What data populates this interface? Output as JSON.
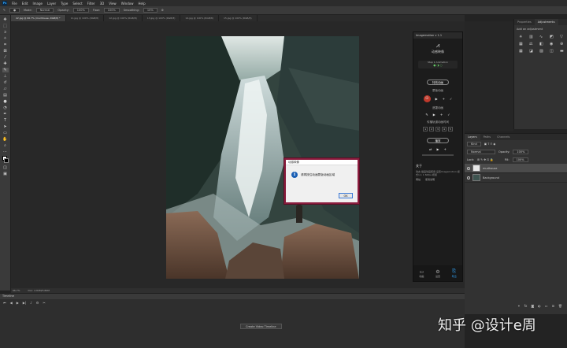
{
  "menubar": {
    "app_logo": "Ps",
    "items": [
      "File",
      "Edit",
      "Image",
      "Layer",
      "Type",
      "Select",
      "Filter",
      "3D",
      "View",
      "Window",
      "Help"
    ]
  },
  "options": {
    "tool_icon": "brush-icon",
    "mode_label": "Mode:",
    "mode_value": "Normal",
    "opacity_label": "Opacity:",
    "opacity_value": "100%",
    "flow_label": "Flow:",
    "flow_value": "100%",
    "smoothing_label": "Smoothing:",
    "smoothing_value": "10%"
  },
  "tabs": [
    {
      "label": "22.jpg @ 66.7% (mudhouse, RGB/8) *",
      "active": true
    },
    {
      "label": "11.jpg @ 100% (RGB/8)",
      "active": false
    },
    {
      "label": "12.jpg @ 100% (RGB/8)",
      "active": false
    },
    {
      "label": "13.jpg @ 100% (RGB/8)",
      "active": false
    },
    {
      "label": "14.jpg @ 100% (RGB/8)",
      "active": false
    },
    {
      "label": "15.jpg @ 100% (RGB/8)",
      "active": false
    }
  ],
  "status": {
    "zoom": "66.7%",
    "doc": "Doc: 2.64M/5.89M"
  },
  "timeline": {
    "title": "Timeline",
    "create_button": "Create Video Timeline"
  },
  "plugin": {
    "title": "Imagemotion v 1.1",
    "brand": "动感映像",
    "sub": "Step 1 Animation",
    "section1_button": "特效动画",
    "group1_label": "蒙版动画",
    "group2_label": "遮罩动画",
    "group3_label": "传播轨道动画时间",
    "section2_button": "播放",
    "about_title": "关于",
    "about_text": "动态 插画动画使用 设置Imagemotion 模式1.1 1 60fps 视频",
    "link1": "网站",
    "link2": "使用说明",
    "bottom_left": "动画",
    "bottom_mid": "设置",
    "bottom_right": "导出"
  },
  "properties_panel": {
    "tabs": [
      "Properties",
      "Adjustments"
    ],
    "hint": "Add an adjustment"
  },
  "layers_panel": {
    "tabs": [
      "Layers",
      "Paths",
      "Channels"
    ],
    "kind": "Kind",
    "blend": "Normal",
    "opacity_label": "Opacity:",
    "opacity_value": "100%",
    "lock_label": "Lock:",
    "fill_label": "Fill:",
    "fill_value": "100%",
    "layers": [
      {
        "name": "mudhouse",
        "selected": true
      },
      {
        "name": "Background",
        "selected": false
      }
    ]
  },
  "dialog": {
    "title": "动感映像",
    "message": "请再按住动画蒙版动画区域",
    "ok": "OK"
  },
  "watermark": "知乎 @设计e周",
  "colors": {
    "dialog_border": "#8a1d3e",
    "accent": "#31a8ff",
    "plugin_record": "#c0392b"
  }
}
